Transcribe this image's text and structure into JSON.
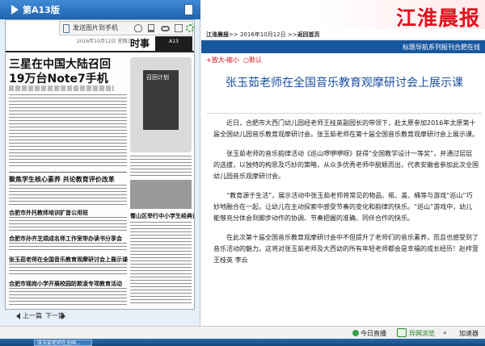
{
  "left_panel": {
    "page_label": "第A13版",
    "toolbar": {
      "send_to_phone": "发送图片到手机"
    },
    "paper": {
      "section": "时事",
      "page_code": "A13",
      "date_line": "2016年10月12日 星期三",
      "headline_1": "三星在中国大陆召回",
      "headline_2": "19万台Note7手机",
      "phone_screen_label": "召回计划",
      "small_headlines": [
        "聚焦学生核心素养 共论教育评价改革",
        "合肥市外托教师培训扩首公用班",
        "合肥市孙齐芝颂成名师工作室举办读书分享会",
        "张玉茹老师在全国音乐教育观摩研讨会上展示课",
        "合肥市瑶岗小学开展校园防欺凌专项教育活动",
        "蜀山区举行中小学生经典诵读展演活动"
      ]
    },
    "pager": {
      "prev": "上一篇",
      "next": "下一篇"
    }
  },
  "masthead": {
    "title": "江淮晨报"
  },
  "breadcrumb": {
    "paper": "江淮晨报",
    "sep": ">>",
    "date": "2016年10月12日",
    "home": "返回首页"
  },
  "nav": {
    "link": "标题导航系列报刊合肥在线"
  },
  "zoom": {
    "in": "放大",
    "out": "缩小",
    "reset": "默认"
  },
  "article": {
    "title": "张玉茹老师在全国音乐教育观摩研讨会上展示课",
    "paragraphs": [
      "近日，合肥市大西门幼儿园经老师王桂英副园长的带领下，赴太原参加2016年太原第十届全国幼儿园音乐教育观摩研讨会。张玉茹老师在第十届全国音乐教育观摩研讨会上展示课。",
      "张玉茹老师的音乐韵律活动《巡山啰咿咿呀》获得“全国教学设计一等奖”，并通过层层的选拔，以独特的构思及巧妙的策略，从众多优秀老师中脱颖而出，代表安徽省参加此次全国幼儿园音乐观摩研讨会。",
      "“教育源于生活”，展示活动中张玉茹老师将常见的物品、瓶、盖、桶等与游戏“巡山”巧妙地融合在一起，让幼儿在主动探索中感受节奏的变化和韵律的快乐。“巡山”游戏中，幼儿能够充分体会到脚步动作的协调、节奏把握的准确、同伴合作的快乐。",
      "在此次第十届全国音乐教育观摩研讨会中不但提升了老师们的音乐素养，而且也感受到了音乐活动的魅力。这将对张玉茹老师及大西幼的所有年轻老师都会是幸福的成长经历！赵梓萱 王桂英 李云"
    ]
  },
  "status_bar": {
    "live": "今日直播",
    "browser": "异网浏览",
    "more": "»",
    "speedup": "加速器"
  },
  "taskbar": {
    "tab": "张玉茹老师在全国..."
  }
}
